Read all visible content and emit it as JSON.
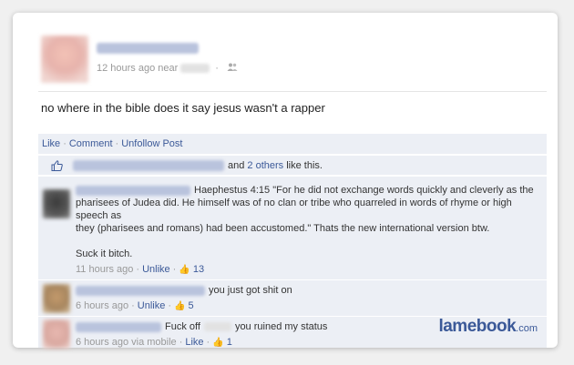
{
  "post": {
    "meta_time": "12 hours ago near",
    "meta_icon": "people-icon",
    "status_text": "no where in the bible does it say jesus wasn't a rapper"
  },
  "actions": {
    "like": "Like",
    "comment": "Comment",
    "unfollow": "Unfollow Post",
    "separator": "·"
  },
  "likes": {
    "and": "and",
    "others_link": "2 others",
    "suffix": "like this."
  },
  "comments": [
    {
      "lines": [
        "Haephestus 4:15 \"For he did not exchange words quickly and cleverly as the",
        "pharisees of Judea did. He himself was of no clan or tribe who quarreled in words of rhyme or high speech as",
        "they (pharisees and romans) had been accustomed.\" Thats the new international version btw.",
        "",
        "Suck it bitch."
      ],
      "time": "11 hours ago",
      "action": "Unlike",
      "likes": "13"
    },
    {
      "text": "you just got shit on",
      "time": "6 hours ago",
      "action": "Unlike",
      "likes": "5"
    },
    {
      "text_before": "Fuck off",
      "text_after": "you ruined my status",
      "time": "6 hours ago via mobile",
      "action": "Like",
      "likes": "1"
    }
  ],
  "watermark": {
    "brand": "lamebook",
    "tld": ".com"
  },
  "colors": {
    "link": "#3b5998",
    "row_bg": "#eceff5",
    "meta_gray": "#999999"
  }
}
